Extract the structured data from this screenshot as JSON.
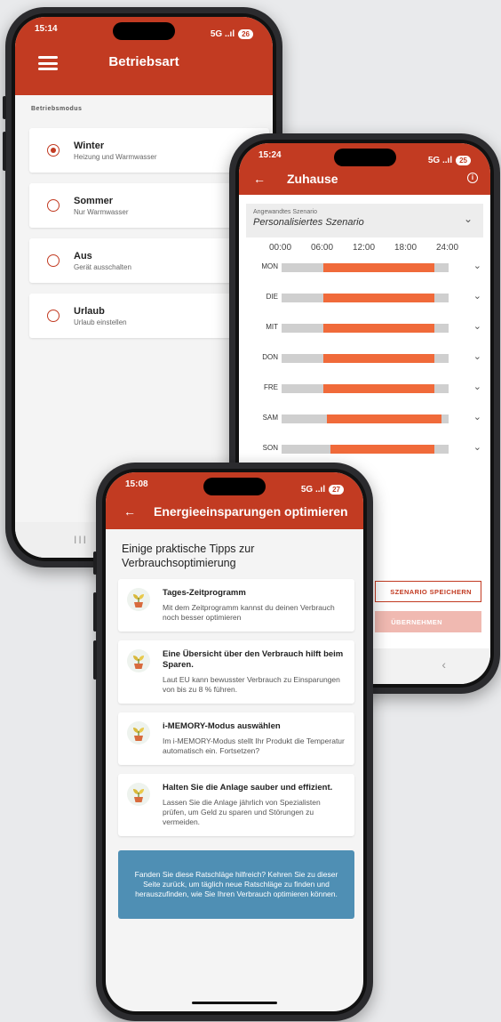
{
  "colors": {
    "brand": "#c23b22",
    "schedule_fill": "#f06a3a",
    "schedule_empty": "#cfcfcf",
    "feedback_bg": "#4f8fb4"
  },
  "phone1": {
    "status": {
      "time": "15:14",
      "signal": "5G ..ıl",
      "battery": "26"
    },
    "title": "Betriebsart",
    "section_label": "Betriebsmodus",
    "modes": [
      {
        "title": "Winter",
        "subtitle": "Heizung und Warmwasser",
        "selected": true
      },
      {
        "title": "Sommer",
        "subtitle": "Nur Warmwasser",
        "selected": false
      },
      {
        "title": "Aus",
        "subtitle": "Gerät ausschalten",
        "selected": false
      },
      {
        "title": "Urlaub",
        "subtitle": "Urlaub einstellen",
        "selected": false
      }
    ],
    "nav_recents": "III"
  },
  "phone2": {
    "status": {
      "time": "15:24",
      "signal": "5G ..ıl",
      "battery": "25"
    },
    "title": "Zuhause",
    "scenario_label": "Angewandtes Szenario",
    "scenario_value": "Personalisiertes Szenario",
    "hours": [
      "00:00",
      "06:00",
      "12:00",
      "18:00",
      "24:00"
    ],
    "days": [
      {
        "name": "MON",
        "start": 6.0,
        "end": 22.0
      },
      {
        "name": "DIE",
        "start": 6.0,
        "end": 22.0
      },
      {
        "name": "MIT",
        "start": 6.0,
        "end": 22.0
      },
      {
        "name": "DON",
        "start": 6.0,
        "end": 22.0
      },
      {
        "name": "FRE",
        "start": 6.0,
        "end": 22.0
      },
      {
        "name": "SAM",
        "start": 6.5,
        "end": 23.0
      },
      {
        "name": "SON",
        "start": 7.0,
        "end": 22.0
      }
    ],
    "save_button": "SZENARIO SPEICHERN",
    "apply_button": "ÜBERNEHMEN"
  },
  "phone3": {
    "status": {
      "time": "15:08",
      "signal": "5G ..ıl",
      "battery": "27"
    },
    "title": "Energieeinsparungen optimieren",
    "intro": "Einige praktische Tipps zur Verbrauchsoptimierung",
    "tips": [
      {
        "title": "Tages-Zeitprogramm",
        "text": "Mit dem Zeitprogramm kannst du deinen Verbrauch noch besser optimieren"
      },
      {
        "title": "Eine Übersicht über den Verbrauch hilft beim Sparen.",
        "text": "Laut EU kann bewusster Verbrauch zu Einsparungen von bis zu 8 % führen."
      },
      {
        "title": "i-MEMORY-Modus auswählen",
        "text": "Im i-MEMORY-Modus stellt Ihr Produkt die Temperatur automatisch ein. Fortsetzen?"
      },
      {
        "title": "Halten Sie die Anlage sauber und effizient.",
        "text": "Lassen Sie die Anlage jährlich von Spezialisten prüfen, um Geld zu sparen und Störungen zu vermeiden."
      }
    ],
    "feedback": "Fanden Sie diese Ratschläge hilfreich? Kehren Sie zu dieser Seite zurück, um täglich neue Ratschläge zu finden und herauszufinden, wie Sie Ihren Verbrauch optimieren können."
  }
}
